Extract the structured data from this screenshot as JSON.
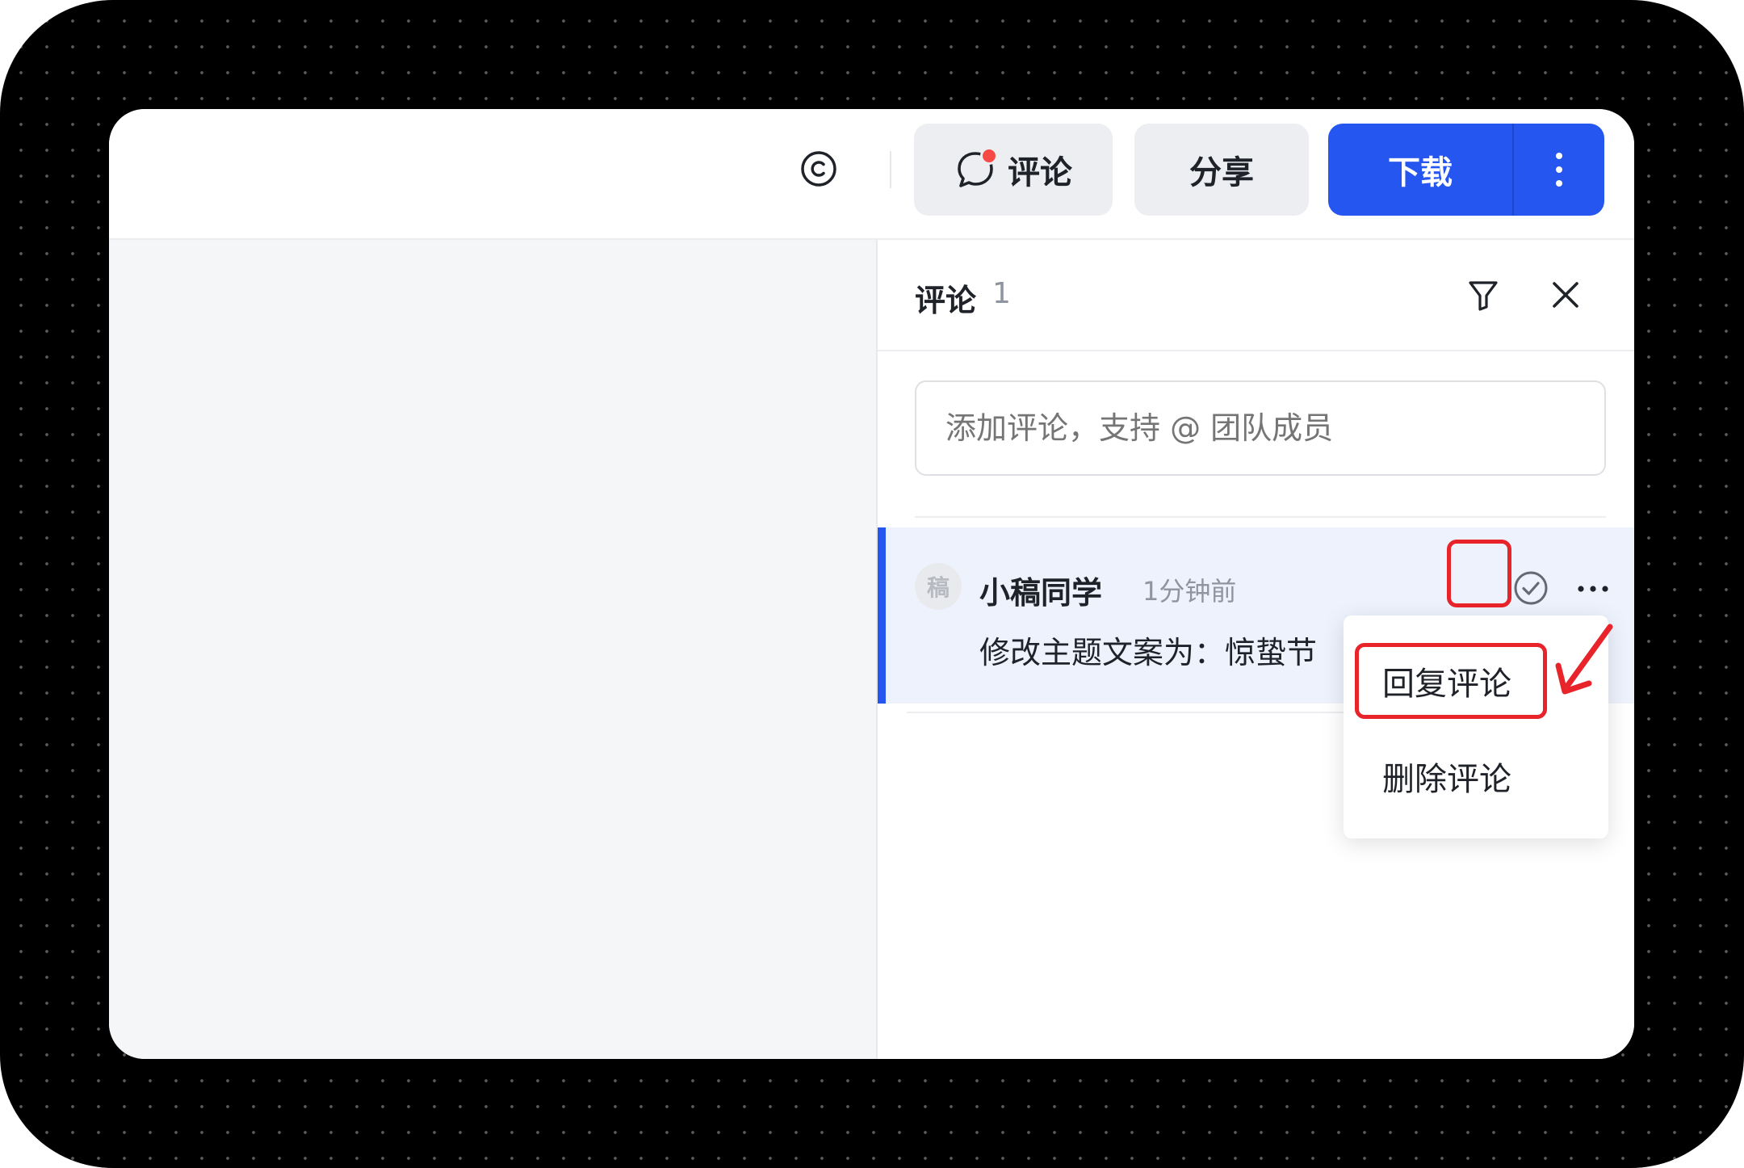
{
  "topbar": {
    "comment_label": "评论",
    "share_label": "分享",
    "download_label": "下载"
  },
  "panel": {
    "title": "评论",
    "count": "1",
    "input_placeholder": "添加评论，支持 @ 团队成员"
  },
  "comment": {
    "avatar_text": "稿",
    "author": "小稿同学",
    "time": "1分钟前",
    "text": "修改主题文案为：惊蛰节"
  },
  "menu": {
    "reply_label": "回复评论",
    "delete_label": "删除评论"
  },
  "colors": {
    "primary": "#2656f0",
    "highlight": "#e8232a",
    "notification_dot": "#f54a45"
  },
  "icons": [
    "copyright-icon",
    "comment-bubble-icon",
    "more-vertical-icon",
    "filter-icon",
    "close-icon",
    "check-circle-icon",
    "more-horizontal-icon",
    "arrow-icon"
  ]
}
